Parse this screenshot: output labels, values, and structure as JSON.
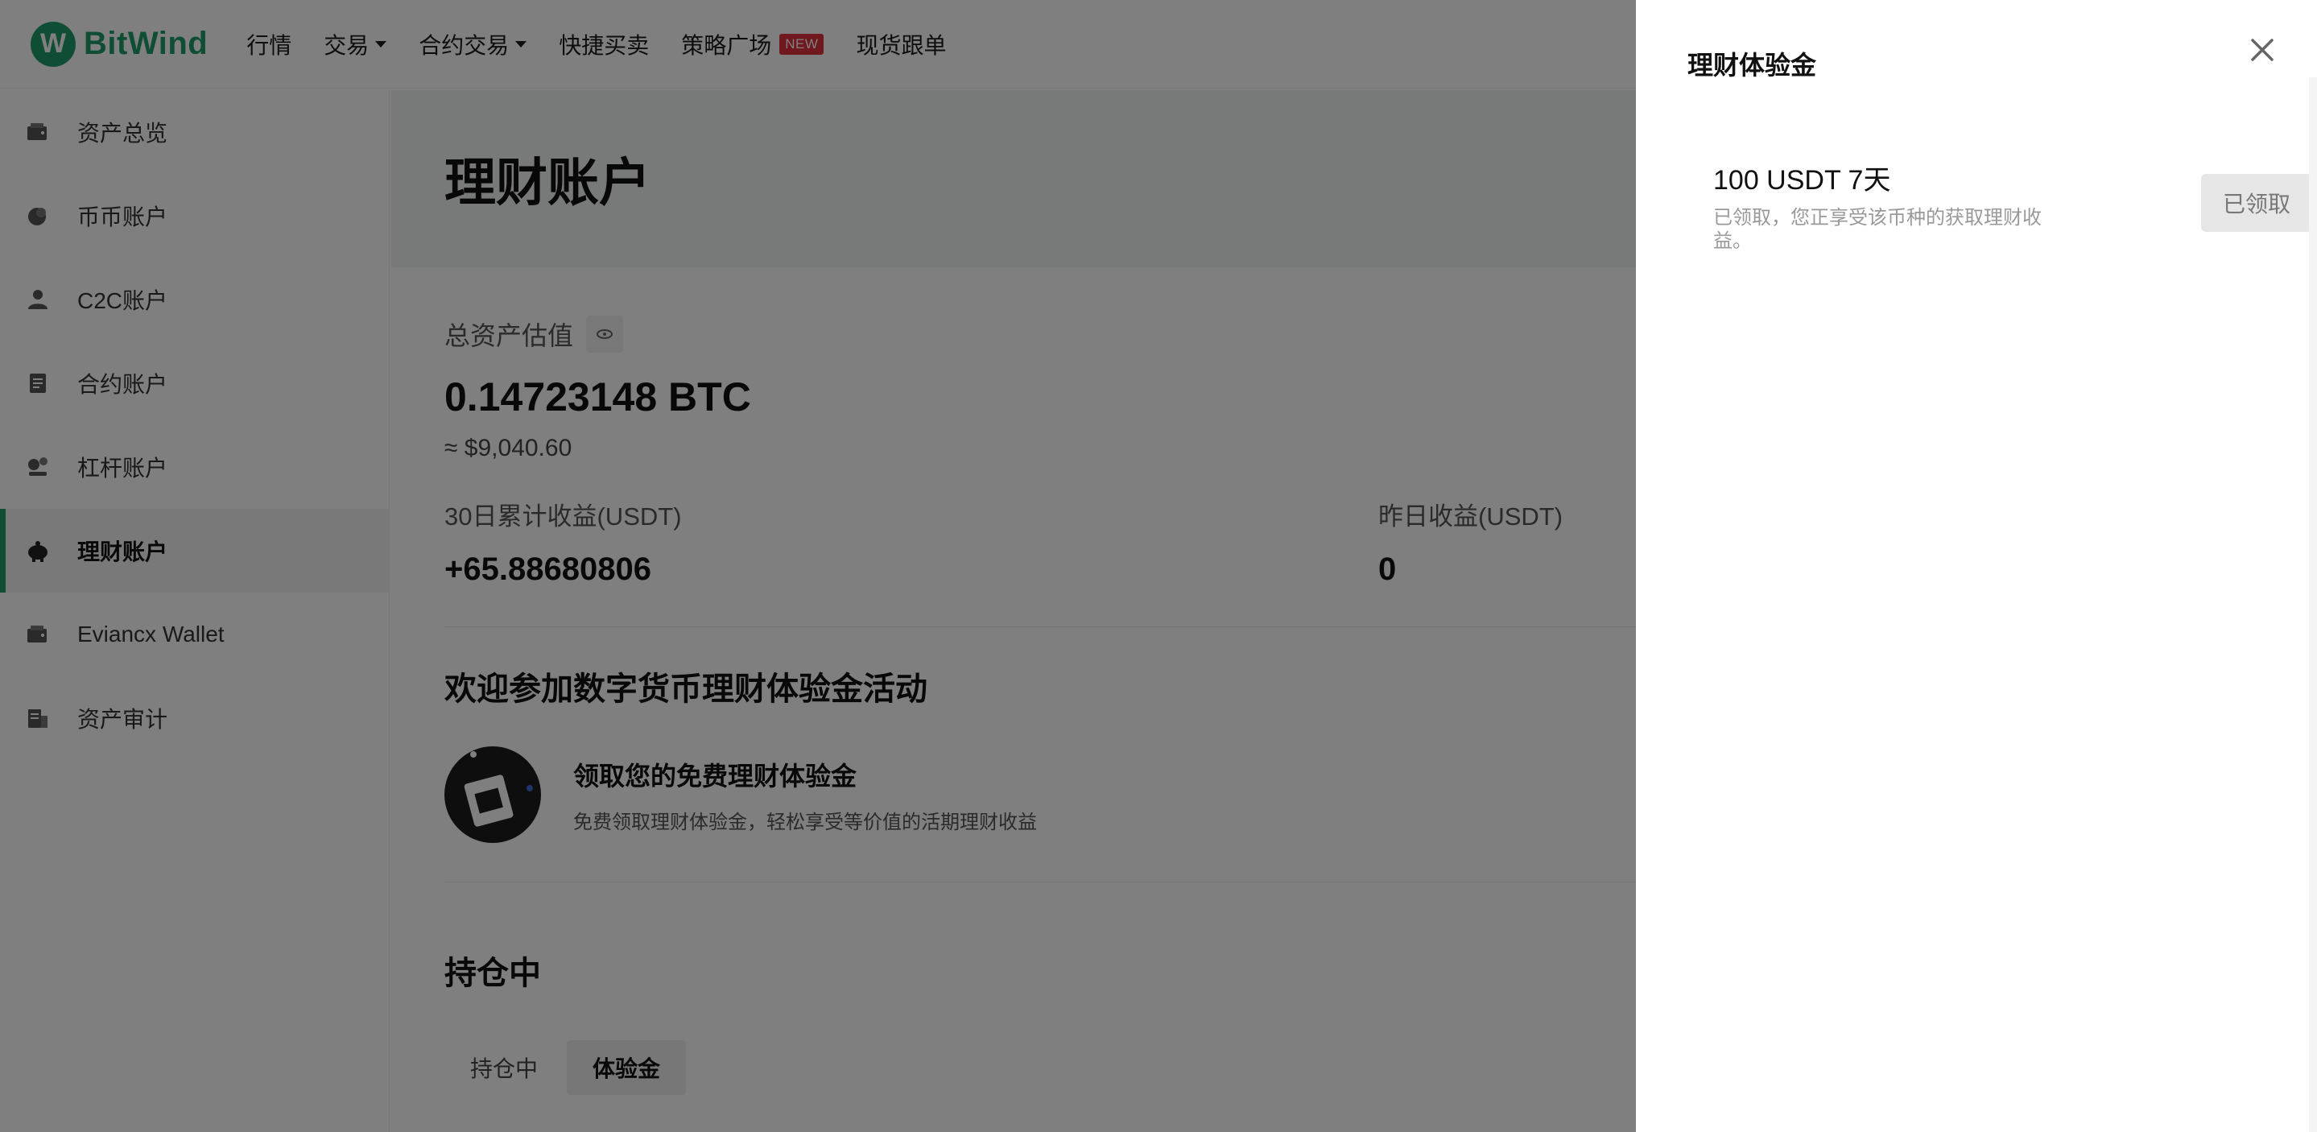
{
  "brand": {
    "name": "BitWind",
    "color": "#1f9d6b",
    "mark": "W"
  },
  "nav": {
    "items": [
      {
        "label": "行情",
        "has_caret": false
      },
      {
        "label": "交易",
        "has_caret": true
      },
      {
        "label": "合约交易",
        "has_caret": true
      },
      {
        "label": "快捷买卖",
        "has_caret": false
      },
      {
        "label": "策略广场",
        "has_caret": false,
        "badge": "NEW"
      },
      {
        "label": "现货跟单",
        "has_caret": false
      }
    ]
  },
  "sidebar": {
    "items": [
      {
        "label": "资产总览",
        "icon": "wallet-icon",
        "active": false
      },
      {
        "label": "币币账户",
        "icon": "coin-icon",
        "active": false
      },
      {
        "label": "C2C账户",
        "icon": "user-icon",
        "active": false
      },
      {
        "label": "合约账户",
        "icon": "contract-icon",
        "active": false
      },
      {
        "label": "杠杆账户",
        "icon": "leverage-icon",
        "active": false
      },
      {
        "label": "理财账户",
        "icon": "piggy-bank-icon",
        "active": true
      },
      {
        "label": "Eviancx Wallet",
        "icon": "wallet-icon",
        "active": false
      },
      {
        "label": "资产审计",
        "icon": "audit-icon",
        "active": false
      }
    ]
  },
  "main": {
    "title": "理财账户",
    "total_label": "总资产估值",
    "btc_value": "0.14723148 BTC",
    "usd_value": "≈ $9,040.60",
    "stats": [
      {
        "label": "30日累计收益(USDT)",
        "value": "+65.88680806"
      },
      {
        "label": "昨日收益(USDT)",
        "value": "0"
      }
    ],
    "promo": {
      "title": "欢迎参加数字货币理财体验金活动",
      "heading": "领取您的免费理财体验金",
      "desc": "免费领取理财体验金，轻松享受等价值的活期理财收益"
    },
    "holding": {
      "title": "持仓中",
      "tabs": [
        {
          "label": "持仓中",
          "active": false
        },
        {
          "label": "体验金",
          "active": true
        }
      ]
    }
  },
  "drawer": {
    "title": "理财体验金",
    "card": {
      "amount": "100 USDT 7天",
      "desc": "已领取，您正享受该币种的获取理财收益。",
      "button": "已领取"
    }
  }
}
